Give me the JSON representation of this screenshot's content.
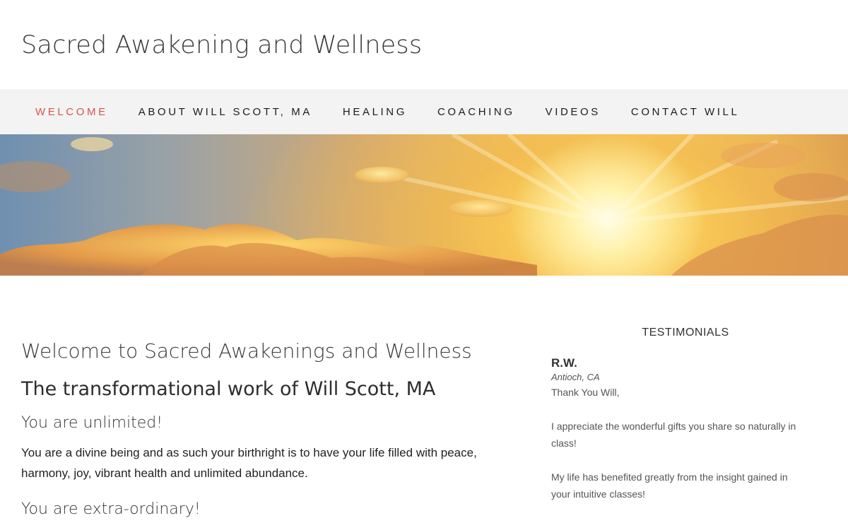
{
  "site": {
    "title": "Sacred Awakening and Wellness"
  },
  "nav": {
    "items": [
      {
        "label": "WELCOME",
        "active": true
      },
      {
        "label": "ABOUT WILL SCOTT, MA",
        "active": false
      },
      {
        "label": "HEALING",
        "active": false
      },
      {
        "label": "COACHING",
        "active": false
      },
      {
        "label": "VIDEOS",
        "active": false
      },
      {
        "label": "CONTACT WILL",
        "active": false
      }
    ],
    "active_color": "#d4574b"
  },
  "main": {
    "heading": "Welcome to Sacred Awakenings and Wellness",
    "subheading": "The transformational work of Will Scott, MA",
    "section1_title": "You are unlimited!",
    "section1_text": "You are a divine being and as such your birthright is to have your life filled with peace, harmony, joy, vibrant health and unlimited abundance.",
    "section2_title": "You are extra-ordinary!"
  },
  "sidebar": {
    "widget_title": "TESTIMONIALS",
    "testimonial": {
      "name": "R.W.",
      "location": "Antioch, CA",
      "paragraphs": [
        "Thank You Will,",
        "I appreciate the wonderful gifts you share so naturally in class!",
        "My life has benefited greatly from the insight gained in your intuitive classes!"
      ]
    }
  }
}
